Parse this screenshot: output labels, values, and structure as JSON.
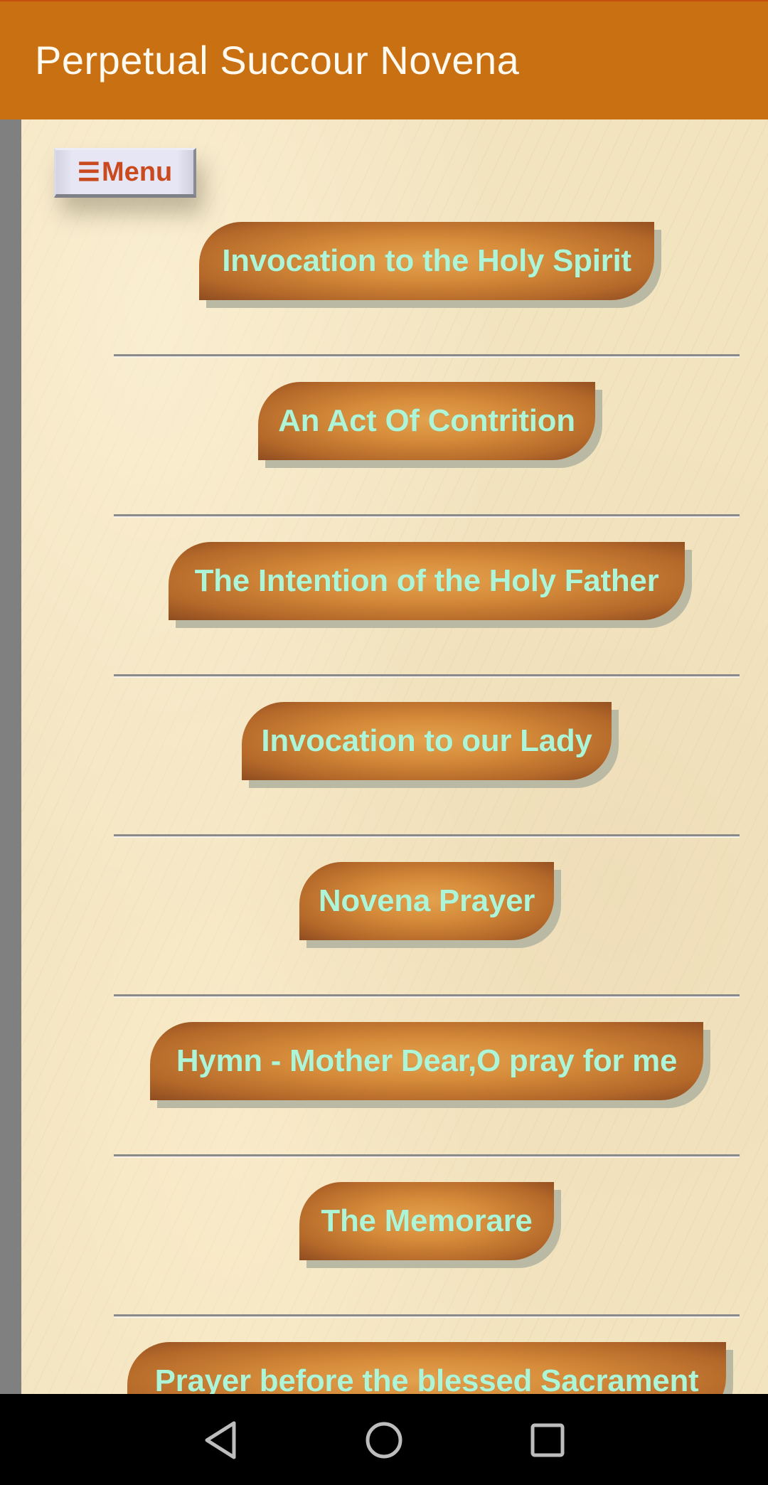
{
  "app_bar": {
    "title": "Perpetual Succour Novena",
    "color": "#c87012"
  },
  "menu_button": {
    "icon": "hamburger-icon",
    "icon_glyph": "☰",
    "label": "Menu",
    "text_color": "#c94a1e"
  },
  "prayers": [
    {
      "label": "Invocation to the Holy Spirit"
    },
    {
      "label": "An Act Of Contrition"
    },
    {
      "label": "The Intention of the Holy Father"
    },
    {
      "label": "Invocation to our Lady"
    },
    {
      "label": "Novena Prayer"
    },
    {
      "label": "Hymn - Mother Dear,O pray for me"
    },
    {
      "label": "The Memorare"
    },
    {
      "label": "Prayer before the blessed Sacrament"
    }
  ],
  "colors": {
    "pill_text": "#aef5d8",
    "pill_base": "#d68c3a",
    "background": "#f3e4c0",
    "divider": "#8a8a8a"
  },
  "system_nav": {
    "back": "back-icon",
    "home": "home-icon",
    "recents": "recents-icon"
  }
}
